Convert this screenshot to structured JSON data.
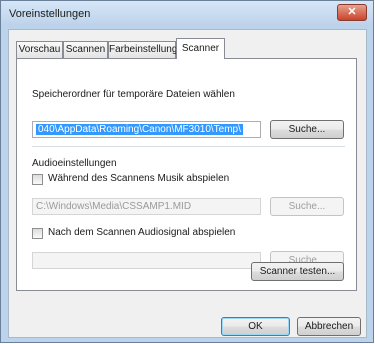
{
  "window": {
    "title": "Voreinstellungen",
    "close_symbol": "✕"
  },
  "tabs": [
    {
      "label": "Vorschau",
      "active": false
    },
    {
      "label": "Scannen",
      "active": false
    },
    {
      "label": "Farbeinstellung",
      "active": false
    },
    {
      "label": "Scanner",
      "active": true
    }
  ],
  "temp_folder": {
    "label": "Speicherordner für temporäre Dateien wählen",
    "path": "040\\AppData\\Roaming\\Canon\\MF3010\\Temp\\",
    "browse_label": "Suche..."
  },
  "audio": {
    "heading": "Audioeinstellungen",
    "music_checkbox_label": "Während des Scannens Musik abspielen",
    "music_checked": false,
    "music_path": "C:\\Windows\\Media\\CSSAMP1.MID",
    "music_browse_label": "Suche...",
    "signal_checkbox_label": "Nach dem Scannen Audiosignal abspielen",
    "signal_checked": false,
    "signal_path": "",
    "signal_browse_label": "Suche..."
  },
  "test_button_label": "Scanner testen...",
  "footer": {
    "ok_label": "OK",
    "cancel_label": "Abbrechen"
  }
}
